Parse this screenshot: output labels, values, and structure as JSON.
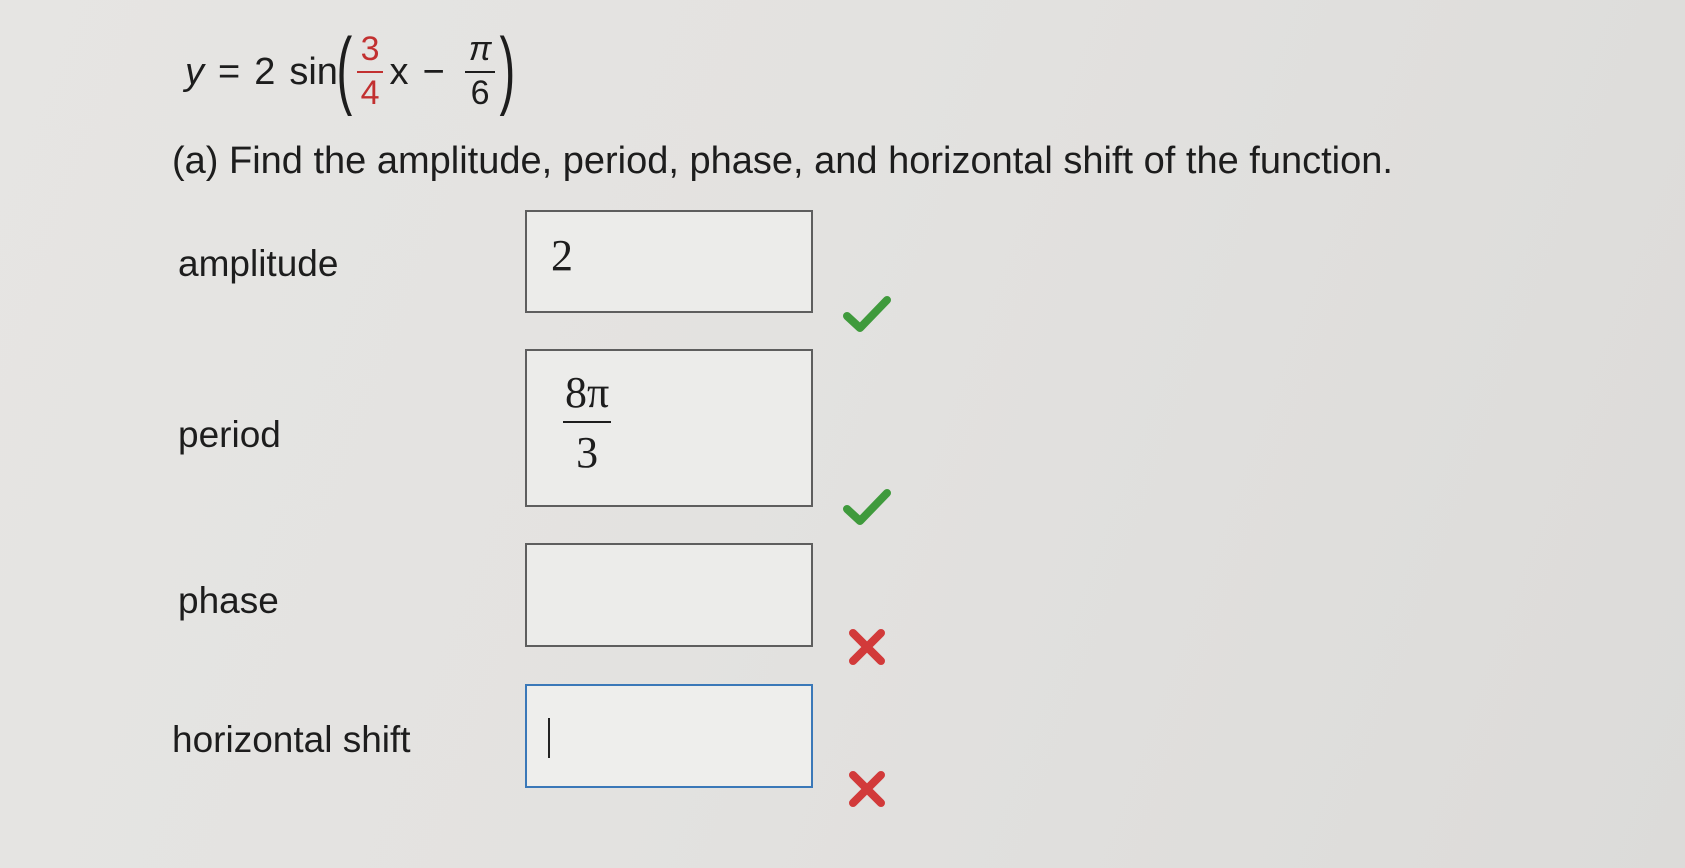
{
  "equation": {
    "lhs": "y",
    "equals": "=",
    "coef": "2",
    "func": "sin",
    "frac1_num": "3",
    "frac1_den": "4",
    "xvar": "x",
    "minus": "−",
    "frac2_num": "π",
    "frac2_den": "6"
  },
  "question": "(a) Find the amplitude, period, phase, and horizontal shift of the function.",
  "rows": {
    "amplitude": {
      "label": "amplitude",
      "value": "2",
      "status": "correct"
    },
    "period": {
      "label": "period",
      "value_num": "8π",
      "value_den": "3",
      "status": "correct"
    },
    "phase": {
      "label": "phase",
      "value": "",
      "status": "incorrect"
    },
    "horizontal_shift": {
      "label": "horizontal shift",
      "value": "",
      "status": "incorrect"
    }
  },
  "colors": {
    "correct": "#3f9a3c",
    "incorrect": "#d23a3a",
    "fraction_accent": "#c23030",
    "focus_border": "#3a78b8"
  }
}
